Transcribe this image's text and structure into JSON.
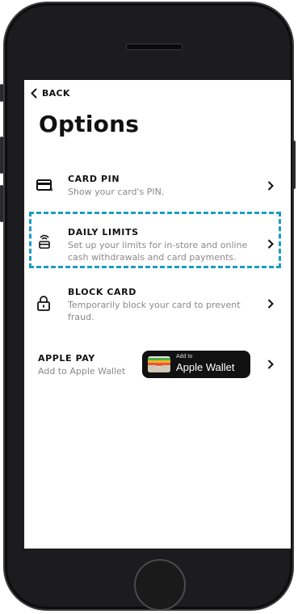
{
  "nav": {
    "back_label": "BACK"
  },
  "page": {
    "title": "Options"
  },
  "options": [
    {
      "title": "CARD PIN",
      "desc": "Show your card's PIN.",
      "icon": "card-pin-icon"
    },
    {
      "title": "DAILY LIMITS",
      "desc": "Set up your limits for in-store and online cash withdrawals and card payments.",
      "icon": "limits-icon"
    },
    {
      "title": "BLOCK CARD",
      "desc": "Temporarily block your card to prevent fraud.",
      "icon": "lock-icon"
    }
  ],
  "apple_pay": {
    "title": "APPLE PAY",
    "desc": "Add to Apple Wallet",
    "wallet_small": "Add to",
    "wallet_big": "Apple Wallet"
  },
  "colors": {
    "highlight": "#1a9cc2",
    "text": "#111111",
    "muted": "#8a8a8a"
  }
}
